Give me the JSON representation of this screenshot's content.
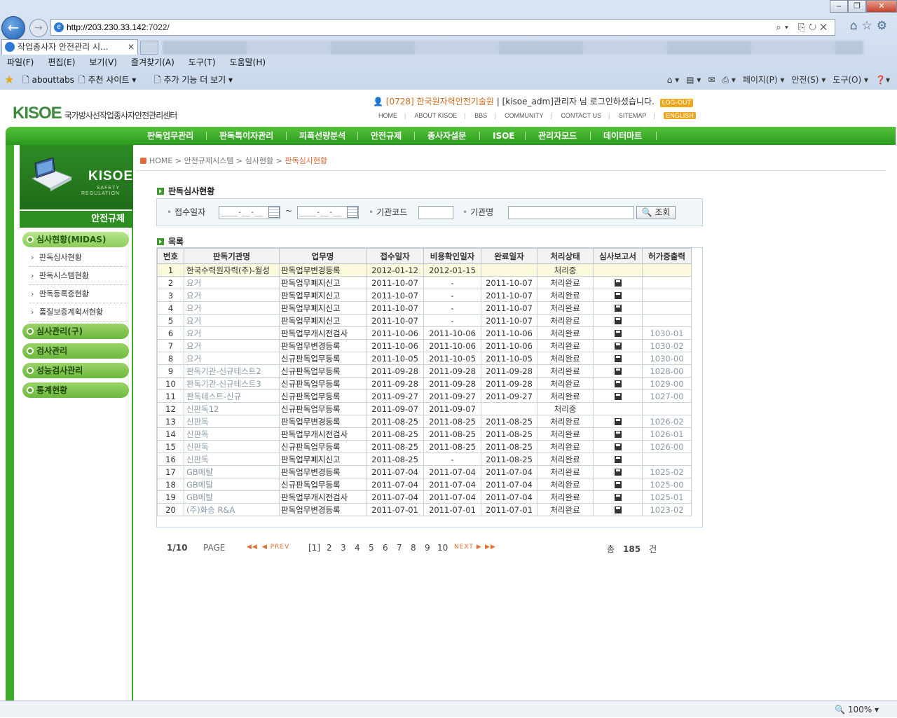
{
  "browser": {
    "url_host": "http://203.230.33.142",
    "url_rest": ":7022/",
    "tab_title": "작업종사자 안전관리 시...",
    "menu": [
      "파일(F)",
      "편집(E)",
      "보기(V)",
      "즐겨찾기(A)",
      "도구(T)",
      "도움말(H)"
    ],
    "favorites": [
      "abouttabs",
      "추천 사이트 ▾",
      "추가 기능 더 보기 ▾"
    ],
    "commands": [
      "페이지(P) ▾",
      "안전(S) ▾",
      "도구(O) ▾"
    ],
    "zoom": "100%"
  },
  "site": {
    "logo": "KISOE",
    "logo_sub": "국가방사선작업종사자안전관리센터",
    "login_code": "[0728]",
    "login_org": "한국원자력안전기술원",
    "login_text": " | [kisoe_adm]관리자 님 로그인하셨습니다.",
    "logout": "LOG-OUT",
    "toplinks": [
      "HOME",
      "ABOUT KISOE",
      "BBS",
      "COMMUNITY",
      "CONTACT US",
      "SITEMAP"
    ],
    "english": "ENGLISH",
    "gnav": [
      "판독업무관리",
      "판독특이자관리",
      "피폭선량분석",
      "안전규제",
      "종사자설문",
      "ISOE",
      "관리자모드",
      "데이터마트"
    ]
  },
  "left": {
    "brand": "KISOE",
    "brand_tag1": "SAFETY",
    "brand_tag2": "REGULATION",
    "title": "안전규제",
    "menus": [
      "심사현황(MIDAS)",
      "심사관리(구)",
      "검사관리",
      "성능검사관리",
      "통계현황"
    ],
    "subs": [
      "판독심사현황",
      "판독시스템현황",
      "판독등록증현황",
      "품질보증계획서현황"
    ]
  },
  "breadcrumb": {
    "home": "HOME",
    "b1": "안전규제시스템",
    "b2": "심사현황",
    "current": "판독심사현황"
  },
  "search": {
    "title": "판독심사현황",
    "date_label": "접수일자",
    "date_placeholder": "____-__-__",
    "tilde": "~",
    "code_label": "기관코드",
    "name_label": "기관명",
    "button": "조회"
  },
  "list": {
    "title": "목록",
    "headers": [
      "번호",
      "판독기관명",
      "업무명",
      "접수일자",
      "비용확인일자",
      "완료일자",
      "처리상태",
      "심사보고서",
      "허가증출력"
    ],
    "rows": [
      [
        "1",
        "한국수력원자력(주)-월성",
        "판독업무변경등록",
        "2012-01-12",
        "2012-01-15",
        "",
        "처리중",
        "",
        ""
      ],
      [
        "2",
        "요거",
        "판독업무폐지신고",
        "2011-10-07",
        "-",
        "2011-10-07",
        "처리완료",
        "disk",
        ""
      ],
      [
        "3",
        "요거",
        "판독업무폐지신고",
        "2011-10-07",
        "-",
        "2011-10-07",
        "처리완료",
        "disk",
        ""
      ],
      [
        "4",
        "요거",
        "판독업무폐지신고",
        "2011-10-07",
        "-",
        "2011-10-07",
        "처리완료",
        "disk",
        ""
      ],
      [
        "5",
        "요거",
        "판독업무폐지신고",
        "2011-10-07",
        "-",
        "2011-10-07",
        "처리완료",
        "disk",
        ""
      ],
      [
        "6",
        "요거",
        "판독업무개시전검사",
        "2011-10-06",
        "2011-10-06",
        "2011-10-06",
        "처리완료",
        "disk",
        "1030-01"
      ],
      [
        "7",
        "요거",
        "판독업무변경등록",
        "2011-10-06",
        "2011-10-06",
        "2011-10-06",
        "처리완료",
        "disk",
        "1030-02"
      ],
      [
        "8",
        "요거",
        "신규판독업무등록",
        "2011-10-05",
        "2011-10-05",
        "2011-10-05",
        "처리완료",
        "disk",
        "1030-00"
      ],
      [
        "9",
        "판독기관-신규테스트2",
        "신규판독업무등록",
        "2011-09-28",
        "2011-09-28",
        "2011-09-28",
        "처리완료",
        "disk",
        "1028-00"
      ],
      [
        "10",
        "판독기관-신규테스트3",
        "신규판독업무등록",
        "2011-09-28",
        "2011-09-28",
        "2011-09-28",
        "처리완료",
        "disk",
        "1029-00"
      ],
      [
        "11",
        "판독테스트-신규",
        "신규판독업무등록",
        "2011-09-27",
        "2011-09-27",
        "2011-09-27",
        "처리완료",
        "disk",
        "1027-00"
      ],
      [
        "12",
        "신판독12",
        "신규판독업무등록",
        "2011-09-07",
        "2011-09-07",
        "",
        "처리중",
        "",
        ""
      ],
      [
        "13",
        "신판독",
        "판독업무변경등록",
        "2011-08-25",
        "2011-08-25",
        "2011-08-25",
        "처리완료",
        "disk",
        "1026-02"
      ],
      [
        "14",
        "신판독",
        "판독업무개시전검사",
        "2011-08-25",
        "2011-08-25",
        "2011-08-25",
        "처리완료",
        "disk",
        "1026-01"
      ],
      [
        "15",
        "신판독",
        "신규판독업무등록",
        "2011-08-25",
        "2011-08-25",
        "2011-08-25",
        "처리완료",
        "disk",
        "1026-00"
      ],
      [
        "16",
        "신판독",
        "판독업무폐지신고",
        "2011-08-25",
        "-",
        "2011-08-25",
        "처리완료",
        "disk",
        ""
      ],
      [
        "17",
        "GB메탈",
        "판독업무변경등록",
        "2011-07-04",
        "2011-07-04",
        "2011-07-04",
        "처리완료",
        "disk",
        "1025-02"
      ],
      [
        "18",
        "GB메탈",
        "신규판독업무등록",
        "2011-07-04",
        "2011-07-04",
        "2011-07-04",
        "처리완료",
        "disk",
        "1025-00"
      ],
      [
        "19",
        "GB메탈",
        "판독업무개시전검사",
        "2011-07-04",
        "2011-07-04",
        "2011-07-04",
        "처리완료",
        "disk",
        "1025-01"
      ],
      [
        "20",
        "(주)화승 R&A",
        "판독업무변경등록",
        "2011-07-01",
        "2011-07-01",
        "2011-07-01",
        "처리완료",
        "disk",
        "1023-02"
      ]
    ]
  },
  "pager": {
    "info": "1/10",
    "page_word": "PAGE",
    "first": "◀◀",
    "prev": "◀ PREV",
    "pages": [
      "[1]",
      "2",
      "3",
      "4",
      "5",
      "6",
      "7",
      "8",
      "9",
      "10"
    ],
    "next": "NEXT ▶",
    "last": "▶▶",
    "total_prefix": "총",
    "total": "185",
    "total_suffix": "건"
  }
}
